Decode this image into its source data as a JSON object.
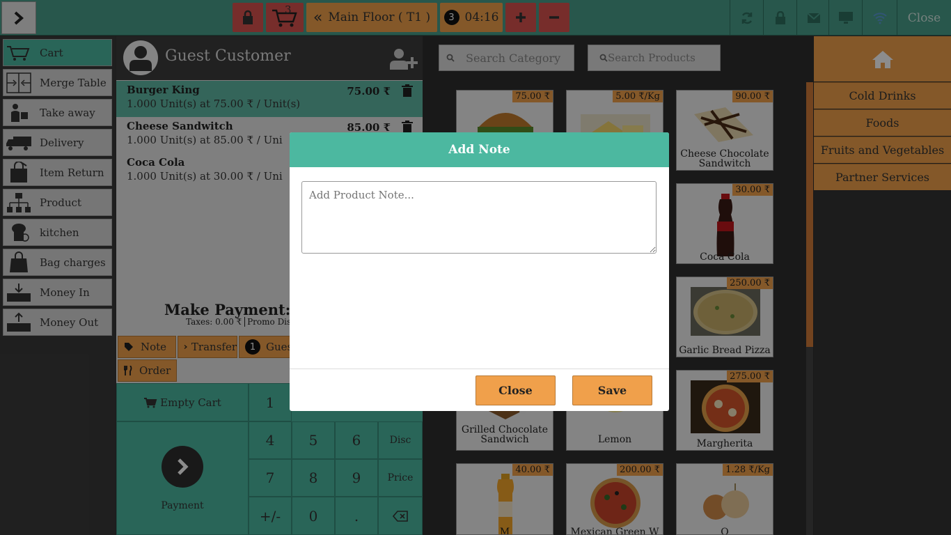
{
  "topbar": {
    "cart_count": "3",
    "floor_label": "Main Floor ( T1 )",
    "guest_count": "3",
    "time": "04:16",
    "close_label": "Close"
  },
  "sidebar": {
    "items": [
      {
        "label": "Cart",
        "icon": "cart-icon"
      },
      {
        "label": "Merge Table",
        "icon": "merge-icon"
      },
      {
        "label": "Take away",
        "icon": "takeaway-icon"
      },
      {
        "label": "Delivery",
        "icon": "truck-icon"
      },
      {
        "label": "Item Return",
        "icon": "return-bag-icon"
      },
      {
        "label": "Product",
        "icon": "hierarchy-icon"
      },
      {
        "label": "kitchen",
        "icon": "kitchen-icon"
      },
      {
        "label": "Bag charges",
        "icon": "bag-icon"
      },
      {
        "label": "Money In",
        "icon": "money-in-icon"
      },
      {
        "label": "Money Out",
        "icon": "money-out-icon"
      }
    ]
  },
  "cart": {
    "customer": "Guest Customer",
    "lines": [
      {
        "name": "Burger King",
        "qty": "1.000 Unit(s) at 75.00 ₹ / Unit(s)",
        "price": "75.00 ₹"
      },
      {
        "name": "Cheese Sandwitch",
        "qty": "1.000 Unit(s) at 85.00 ₹ / Uni",
        "price": "85.00 ₹"
      },
      {
        "name": "Coca Cola",
        "qty": "1.000 Unit(s) at 30.00 ₹ / Uni",
        "price": ""
      }
    ],
    "make_payment": "Make Payment:",
    "taxes": "Taxes: 0.00 ₹",
    "promo": "Promo Dis",
    "actions": {
      "note": "Note",
      "transfer": "Transfer",
      "guest_badge": "1",
      "guest": "Guest",
      "order": "Order"
    },
    "pad": {
      "empty_cart": "Empty Cart",
      "payment": "Payment",
      "k1": "1",
      "k4": "4",
      "k5": "5",
      "k6": "6",
      "disc": "Disc",
      "k7": "7",
      "k8": "8",
      "k9": "9",
      "price": "Price",
      "plusminus": "+/-",
      "k0": "0",
      "dot": "."
    }
  },
  "products": {
    "search_category_placeholder": "Search Category",
    "search_products_placeholder": "Search Products",
    "tiles": [
      {
        "name": "",
        "price": "75.00 ₹"
      },
      {
        "name": "",
        "price": "5.00 ₹/Kg"
      },
      {
        "name": "Cheese Chocolate Sandwitch",
        "price": "90.00 ₹"
      },
      {
        "name": "Coca Cola",
        "price": "30.00 ₹"
      },
      {
        "name": "Garlic Bread Pizza",
        "price": "250.00 ₹"
      },
      {
        "name": "Grilled Chocolate Sandwich",
        "price": ""
      },
      {
        "name": "Lemon",
        "price": ""
      },
      {
        "name": "Margherita",
        "price": "275.00 ₹"
      },
      {
        "name": "M",
        "price": "40.00 ₹"
      },
      {
        "name": "Mexican Green W",
        "price": "200.00 ₹"
      },
      {
        "name": "O",
        "price": "1.28 ₹/Kg"
      }
    ]
  },
  "categories": {
    "items": [
      "Cold Drinks",
      "Foods",
      "Fruits and Vegetables",
      "Partner Services"
    ]
  },
  "modal": {
    "title": "Add Note",
    "note_placeholder": "Add Product Note...",
    "close": "Close",
    "save": "Save"
  }
}
